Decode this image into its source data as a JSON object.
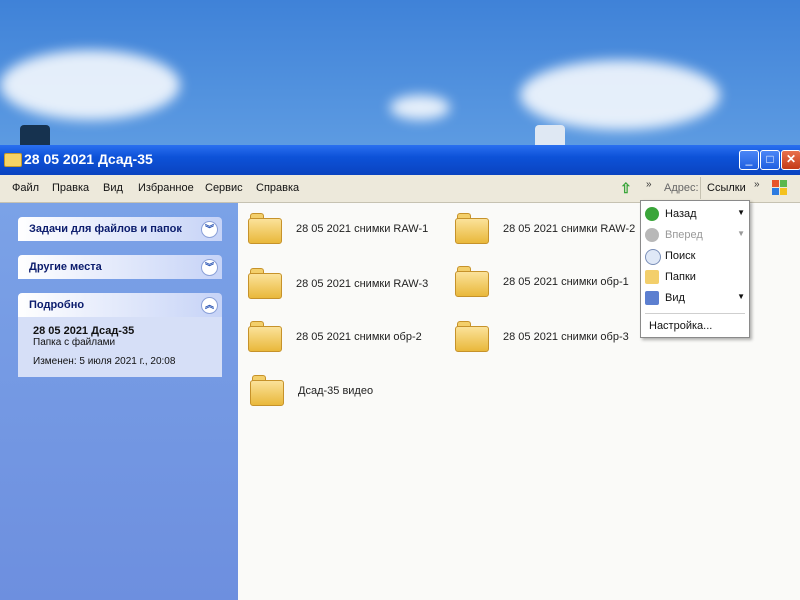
{
  "window": {
    "title": "28 05 2021 Дсад-35",
    "controls": {
      "minimize": "_",
      "maximize": "□",
      "close": "✕"
    }
  },
  "menu": [
    "Файл",
    "Правка",
    "Вид",
    "Избранное",
    "Сервис",
    "Справка"
  ],
  "toolbar": {
    "address_label": "Адрес:",
    "links_label": "Ссылки",
    "chevron": "»"
  },
  "tasks": {
    "file_tasks": "Задачи для файлов и папок",
    "other_places": "Другие места",
    "details": {
      "title": "Подробно",
      "name": "28 05 2021 Дсад-35",
      "type": "Папка с файлами",
      "modified": "Изменен: 5 июля 2021 г., 20:08"
    }
  },
  "files": [
    "28 05 2021 снимки RAW-1",
    "28 05 2021 снимки RAW-2",
    "28 05 2021 снимки RAW-3",
    "28 05 2021 снимки обр-1",
    "28 05 2021 снимки обр-2",
    "28 05 2021 снимки обр-3",
    "Дсад-35 видео"
  ],
  "dropdown": {
    "back": "Назад",
    "forward": "Вперед",
    "search": "Поиск",
    "folders": "Папки",
    "view": "Вид",
    "customize": "Настройка..."
  },
  "colors": {
    "title_bar": "#0a43c0",
    "task_pane": "#6d8fdf",
    "folder": "#e9b83b",
    "back_icon": "#3aa53a"
  }
}
